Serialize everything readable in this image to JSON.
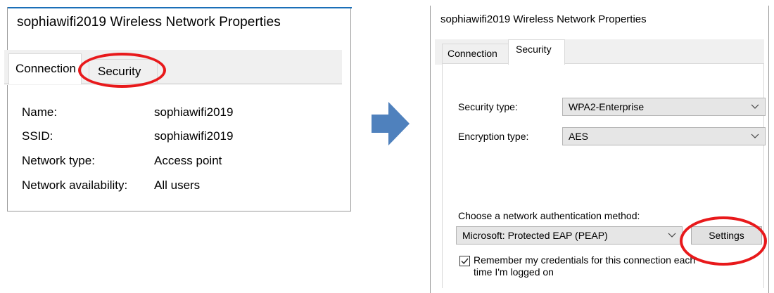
{
  "left": {
    "title": "sophiawifi2019 Wireless Network Properties",
    "tabs": {
      "connection": "Connection",
      "security": "Security"
    },
    "properties": [
      {
        "key": "Name:",
        "value": "sophiawifi2019"
      },
      {
        "key": "SSID:",
        "value": "sophiawifi2019"
      },
      {
        "key": "Network type:",
        "value": "Access point"
      },
      {
        "key": "Network availability:",
        "value": "All users"
      }
    ]
  },
  "right": {
    "title": "sophiawifi2019 Wireless Network Properties",
    "tabs": {
      "connection": "Connection",
      "security": "Security"
    },
    "security_type": {
      "label": "Security type:",
      "value": "WPA2-Enterprise"
    },
    "encryption_type": {
      "label": "Encryption type:",
      "value": "AES"
    },
    "auth_method": {
      "label": "Choose a network authentication method:",
      "value": "Microsoft: Protected EAP (PEAP)",
      "settings_button": "Settings"
    },
    "remember": {
      "line1": "Remember my credentials for this connection each",
      "line2": "time I'm logged on",
      "checked": true
    }
  },
  "colors": {
    "highlight_circle": "#e8191b",
    "arrow": "#4f81bd",
    "tab_strip": "#f0f0f0",
    "dropdown_bg": "#e6e6e6",
    "title_accent": "#1b6fb8"
  },
  "icons": [
    "arrow-right-icon",
    "chevron-down-icon",
    "checkmark-icon"
  ]
}
